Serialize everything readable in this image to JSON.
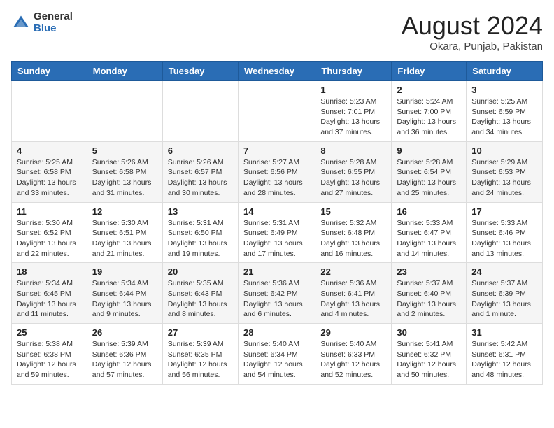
{
  "header": {
    "logo_general": "General",
    "logo_blue": "Blue",
    "month_title": "August 2024",
    "location": "Okara, Punjab, Pakistan"
  },
  "weekdays": [
    "Sunday",
    "Monday",
    "Tuesday",
    "Wednesday",
    "Thursday",
    "Friday",
    "Saturday"
  ],
  "weeks": [
    [
      {
        "day": "",
        "info": ""
      },
      {
        "day": "",
        "info": ""
      },
      {
        "day": "",
        "info": ""
      },
      {
        "day": "",
        "info": ""
      },
      {
        "day": "1",
        "info": "Sunrise: 5:23 AM\nSunset: 7:01 PM\nDaylight: 13 hours\nand 37 minutes."
      },
      {
        "day": "2",
        "info": "Sunrise: 5:24 AM\nSunset: 7:00 PM\nDaylight: 13 hours\nand 36 minutes."
      },
      {
        "day": "3",
        "info": "Sunrise: 5:25 AM\nSunset: 6:59 PM\nDaylight: 13 hours\nand 34 minutes."
      }
    ],
    [
      {
        "day": "4",
        "info": "Sunrise: 5:25 AM\nSunset: 6:58 PM\nDaylight: 13 hours\nand 33 minutes."
      },
      {
        "day": "5",
        "info": "Sunrise: 5:26 AM\nSunset: 6:58 PM\nDaylight: 13 hours\nand 31 minutes."
      },
      {
        "day": "6",
        "info": "Sunrise: 5:26 AM\nSunset: 6:57 PM\nDaylight: 13 hours\nand 30 minutes."
      },
      {
        "day": "7",
        "info": "Sunrise: 5:27 AM\nSunset: 6:56 PM\nDaylight: 13 hours\nand 28 minutes."
      },
      {
        "day": "8",
        "info": "Sunrise: 5:28 AM\nSunset: 6:55 PM\nDaylight: 13 hours\nand 27 minutes."
      },
      {
        "day": "9",
        "info": "Sunrise: 5:28 AM\nSunset: 6:54 PM\nDaylight: 13 hours\nand 25 minutes."
      },
      {
        "day": "10",
        "info": "Sunrise: 5:29 AM\nSunset: 6:53 PM\nDaylight: 13 hours\nand 24 minutes."
      }
    ],
    [
      {
        "day": "11",
        "info": "Sunrise: 5:30 AM\nSunset: 6:52 PM\nDaylight: 13 hours\nand 22 minutes."
      },
      {
        "day": "12",
        "info": "Sunrise: 5:30 AM\nSunset: 6:51 PM\nDaylight: 13 hours\nand 21 minutes."
      },
      {
        "day": "13",
        "info": "Sunrise: 5:31 AM\nSunset: 6:50 PM\nDaylight: 13 hours\nand 19 minutes."
      },
      {
        "day": "14",
        "info": "Sunrise: 5:31 AM\nSunset: 6:49 PM\nDaylight: 13 hours\nand 17 minutes."
      },
      {
        "day": "15",
        "info": "Sunrise: 5:32 AM\nSunset: 6:48 PM\nDaylight: 13 hours\nand 16 minutes."
      },
      {
        "day": "16",
        "info": "Sunrise: 5:33 AM\nSunset: 6:47 PM\nDaylight: 13 hours\nand 14 minutes."
      },
      {
        "day": "17",
        "info": "Sunrise: 5:33 AM\nSunset: 6:46 PM\nDaylight: 13 hours\nand 13 minutes."
      }
    ],
    [
      {
        "day": "18",
        "info": "Sunrise: 5:34 AM\nSunset: 6:45 PM\nDaylight: 13 hours\nand 11 minutes."
      },
      {
        "day": "19",
        "info": "Sunrise: 5:34 AM\nSunset: 6:44 PM\nDaylight: 13 hours\nand 9 minutes."
      },
      {
        "day": "20",
        "info": "Sunrise: 5:35 AM\nSunset: 6:43 PM\nDaylight: 13 hours\nand 8 minutes."
      },
      {
        "day": "21",
        "info": "Sunrise: 5:36 AM\nSunset: 6:42 PM\nDaylight: 13 hours\nand 6 minutes."
      },
      {
        "day": "22",
        "info": "Sunrise: 5:36 AM\nSunset: 6:41 PM\nDaylight: 13 hours\nand 4 minutes."
      },
      {
        "day": "23",
        "info": "Sunrise: 5:37 AM\nSunset: 6:40 PM\nDaylight: 13 hours\nand 2 minutes."
      },
      {
        "day": "24",
        "info": "Sunrise: 5:37 AM\nSunset: 6:39 PM\nDaylight: 13 hours\nand 1 minute."
      }
    ],
    [
      {
        "day": "25",
        "info": "Sunrise: 5:38 AM\nSunset: 6:38 PM\nDaylight: 12 hours\nand 59 minutes."
      },
      {
        "day": "26",
        "info": "Sunrise: 5:39 AM\nSunset: 6:36 PM\nDaylight: 12 hours\nand 57 minutes."
      },
      {
        "day": "27",
        "info": "Sunrise: 5:39 AM\nSunset: 6:35 PM\nDaylight: 12 hours\nand 56 minutes."
      },
      {
        "day": "28",
        "info": "Sunrise: 5:40 AM\nSunset: 6:34 PM\nDaylight: 12 hours\nand 54 minutes."
      },
      {
        "day": "29",
        "info": "Sunrise: 5:40 AM\nSunset: 6:33 PM\nDaylight: 12 hours\nand 52 minutes."
      },
      {
        "day": "30",
        "info": "Sunrise: 5:41 AM\nSunset: 6:32 PM\nDaylight: 12 hours\nand 50 minutes."
      },
      {
        "day": "31",
        "info": "Sunrise: 5:42 AM\nSunset: 6:31 PM\nDaylight: 12 hours\nand 48 minutes."
      }
    ]
  ]
}
